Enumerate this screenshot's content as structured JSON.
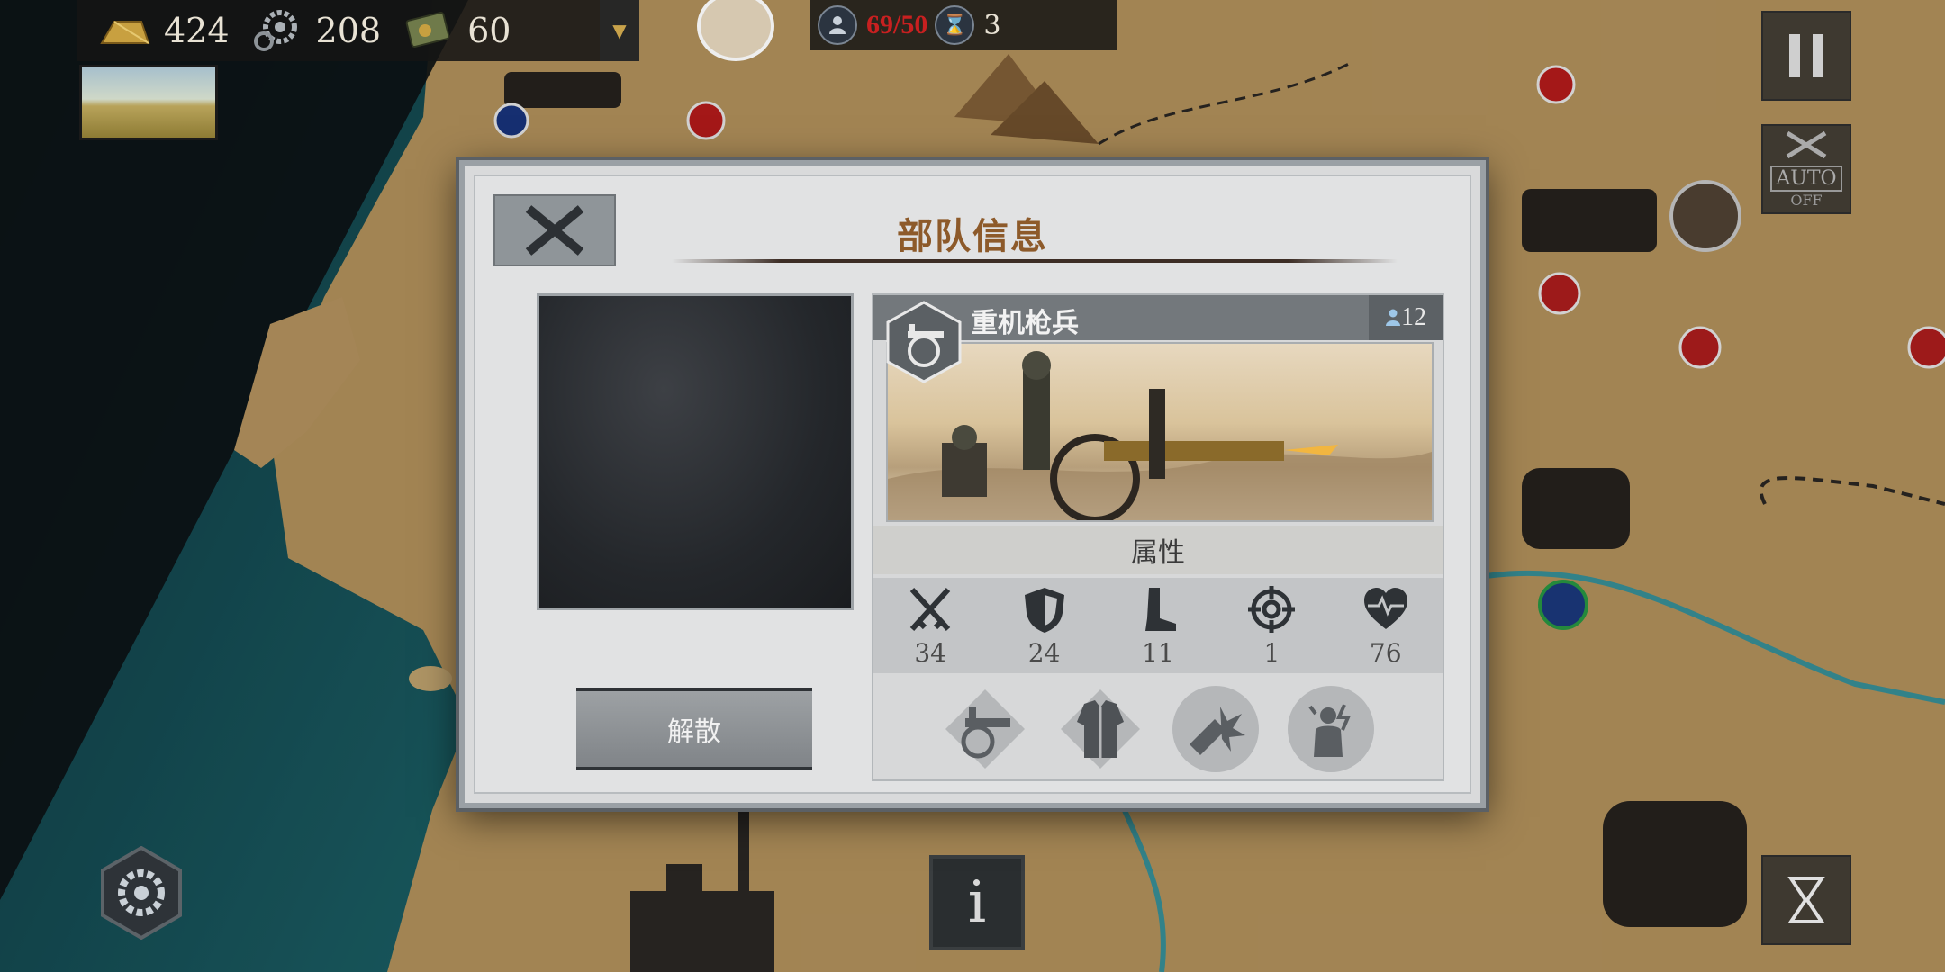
{
  "resources": [
    {
      "name": "gold-icon",
      "value": "424"
    },
    {
      "name": "industry-gear-icon",
      "value": "208"
    },
    {
      "name": "medal-icon",
      "value": "60"
    }
  ],
  "status": {
    "command_value": "69/50",
    "hourglass_value": "3"
  },
  "controls": {
    "auto_label": "AUTO",
    "auto_state": "OFF",
    "info_label": "i"
  },
  "dialog": {
    "title": "部队信息",
    "disband_label": "解散",
    "unit": {
      "name": "重机枪兵",
      "count": "12",
      "attributes_header": "属性",
      "stats": [
        {
          "icon": "attack-swords-icon",
          "value": "34"
        },
        {
          "icon": "defense-shield-icon",
          "value": "24"
        },
        {
          "icon": "movement-boot-icon",
          "value": "11"
        },
        {
          "icon": "range-crosshair-icon",
          "value": "1"
        },
        {
          "icon": "health-heart-icon",
          "value": "76"
        }
      ],
      "skills": [
        "machine-gun-skill-icon",
        "armor-jacket-skill-icon",
        "explosive-shell-skill-icon",
        "morale-shock-skill-icon"
      ]
    }
  },
  "colors": {
    "title": "#8d5a2a",
    "command_value": "#c82020",
    "panel_bg": "#e1e2e3",
    "unit_header": "#73787c"
  }
}
